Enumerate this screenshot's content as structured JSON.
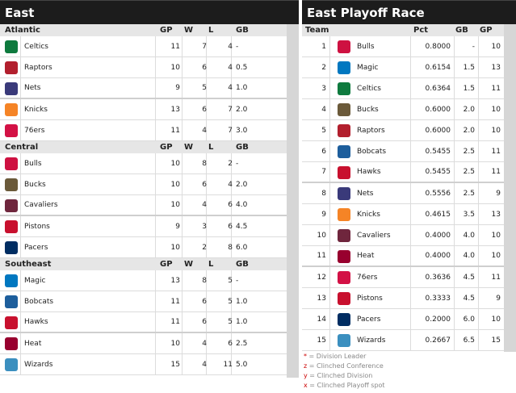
{
  "east": {
    "title": "East",
    "divisions": [
      {
        "name": "Atlantic",
        "headers": [
          "GP",
          "W",
          "L",
          "GB"
        ],
        "teams": [
          {
            "name": "Celtics",
            "gp": "11",
            "w": "7",
            "l": "4",
            "gb": "-",
            "logo_color": "#0e7a3e"
          },
          {
            "name": "Raptors",
            "gp": "10",
            "w": "6",
            "l": "4",
            "gb": "0.5",
            "logo_color": "#b21f2d"
          },
          {
            "name": "Nets",
            "gp": "9",
            "w": "5",
            "l": "4",
            "gb": "1.0",
            "logo_color": "#3a3a7a"
          },
          {
            "name": "Knicks",
            "gp": "13",
            "w": "6",
            "l": "7",
            "gb": "2.0",
            "logo_color": "#f58426"
          },
          {
            "name": "76ers",
            "gp": "11",
            "w": "4",
            "l": "7",
            "gb": "3.0",
            "logo_color": "#d31145"
          }
        ]
      },
      {
        "name": "Central",
        "headers": [
          "GP",
          "W",
          "L",
          "GB"
        ],
        "teams": [
          {
            "name": "Bulls",
            "gp": "10",
            "w": "8",
            "l": "2",
            "gb": "-",
            "logo_color": "#ce1141"
          },
          {
            "name": "Bucks",
            "gp": "10",
            "w": "6",
            "l": "4",
            "gb": "2.0",
            "logo_color": "#6b5a3a"
          },
          {
            "name": "Cavaliers",
            "gp": "10",
            "w": "4",
            "l": "6",
            "gb": "4.0",
            "logo_color": "#6f263d"
          },
          {
            "name": "Pistons",
            "gp": "9",
            "w": "3",
            "l": "6",
            "gb": "4.5",
            "logo_color": "#c8102e"
          },
          {
            "name": "Pacers",
            "gp": "10",
            "w": "2",
            "l": "8",
            "gb": "6.0",
            "logo_color": "#002d62"
          }
        ]
      },
      {
        "name": "Southeast",
        "headers": [
          "GP",
          "W",
          "L",
          "GB"
        ],
        "teams": [
          {
            "name": "Magic",
            "gp": "13",
            "w": "8",
            "l": "5",
            "gb": "-",
            "logo_color": "#0077c0"
          },
          {
            "name": "Bobcats",
            "gp": "11",
            "w": "6",
            "l": "5",
            "gb": "1.0",
            "logo_color": "#1d5e9c"
          },
          {
            "name": "Hawks",
            "gp": "11",
            "w": "6",
            "l": "5",
            "gb": "1.0",
            "logo_color": "#c8102e"
          },
          {
            "name": "Heat",
            "gp": "10",
            "w": "4",
            "l": "6",
            "gb": "2.5",
            "logo_color": "#98002e"
          },
          {
            "name": "Wizards",
            "gp": "15",
            "w": "4",
            "l": "11",
            "gb": "5.0",
            "logo_color": "#3b8fbf"
          }
        ]
      }
    ]
  },
  "race": {
    "title": "East Playoff Race",
    "headers": {
      "team": "Team",
      "pct": "Pct",
      "gb": "GB",
      "gp": "GP"
    },
    "rows": [
      {
        "rank": "1",
        "name": "Bulls",
        "pct": "0.8000",
        "gb": "-",
        "gp": "10",
        "logo_color": "#ce1141"
      },
      {
        "rank": "2",
        "name": "Magic",
        "pct": "0.6154",
        "gb": "1.5",
        "gp": "13",
        "logo_color": "#0077c0"
      },
      {
        "rank": "3",
        "name": "Celtics",
        "pct": "0.6364",
        "gb": "1.5",
        "gp": "11",
        "logo_color": "#0e7a3e"
      },
      {
        "rank": "4",
        "name": "Bucks",
        "pct": "0.6000",
        "gb": "2.0",
        "gp": "10",
        "logo_color": "#6b5a3a"
      },
      {
        "rank": "5",
        "name": "Raptors",
        "pct": "0.6000",
        "gb": "2.0",
        "gp": "10",
        "logo_color": "#b21f2d"
      },
      {
        "rank": "6",
        "name": "Bobcats",
        "pct": "0.5455",
        "gb": "2.5",
        "gp": "11",
        "logo_color": "#1d5e9c"
      },
      {
        "rank": "7",
        "name": "Hawks",
        "pct": "0.5455",
        "gb": "2.5",
        "gp": "11",
        "logo_color": "#c8102e"
      },
      {
        "rank": "8",
        "name": "Nets",
        "pct": "0.5556",
        "gb": "2.5",
        "gp": "9",
        "logo_color": "#3a3a7a"
      },
      {
        "rank": "9",
        "name": "Knicks",
        "pct": "0.4615",
        "gb": "3.5",
        "gp": "13",
        "logo_color": "#f58426"
      },
      {
        "rank": "10",
        "name": "Cavaliers",
        "pct": "0.4000",
        "gb": "4.0",
        "gp": "10",
        "logo_color": "#6f263d"
      },
      {
        "rank": "11",
        "name": "Heat",
        "pct": "0.4000",
        "gb": "4.0",
        "gp": "10",
        "logo_color": "#98002e"
      },
      {
        "rank": "12",
        "name": "76ers",
        "pct": "0.3636",
        "gb": "4.5",
        "gp": "11",
        "logo_color": "#d31145"
      },
      {
        "rank": "13",
        "name": "Pistons",
        "pct": "0.3333",
        "gb": "4.5",
        "gp": "9",
        "logo_color": "#c8102e"
      },
      {
        "rank": "14",
        "name": "Pacers",
        "pct": "0.2000",
        "gb": "6.0",
        "gp": "10",
        "logo_color": "#002d62"
      },
      {
        "rank": "15",
        "name": "Wizards",
        "pct": "0.2667",
        "gb": "6.5",
        "gp": "15",
        "logo_color": "#3b8fbf"
      }
    ]
  },
  "legend": [
    {
      "symbol": "*",
      "text": " = Division Leader"
    },
    {
      "symbol": "z",
      "text": " = Clinched Conference"
    },
    {
      "symbol": "y",
      "text": " = Clinched Division"
    },
    {
      "symbol": "x",
      "text": " = Clinched Playoff spot"
    }
  ]
}
